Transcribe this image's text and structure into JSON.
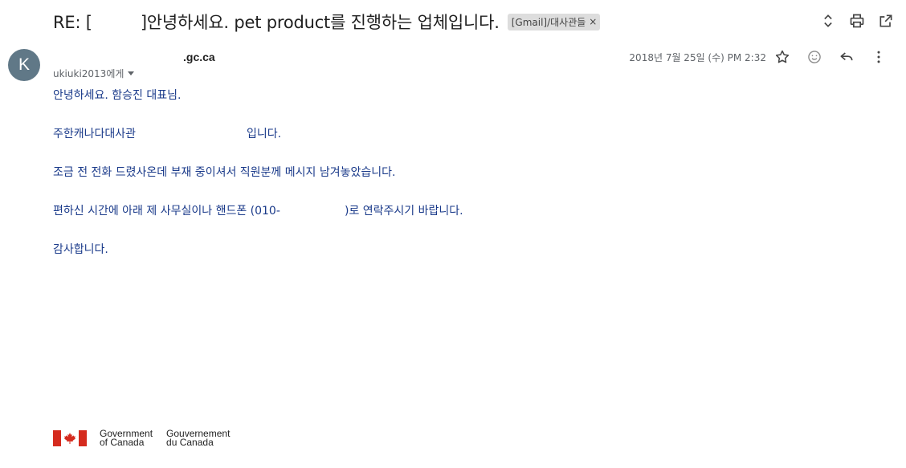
{
  "subject": {
    "prefix": "RE: [",
    "rest": "]안녕하세요. pet product를 진행하는 업체입니다.",
    "label": "[Gmail]/대사관들",
    "label_remove": "×"
  },
  "top_actions": {
    "icons": [
      "expand-collapse-icon",
      "print-icon",
      "open-in-new-window-icon"
    ]
  },
  "message": {
    "avatar_letter": "K",
    "sender": ".gc.ca",
    "recipient": "ukiuki2013에게",
    "date": "2018년 7월 25일 (수) PM 2:32",
    "icons": [
      "star-icon",
      "emoji-icon",
      "reply-icon",
      "more-vert-icon"
    ]
  },
  "body": {
    "lines": [
      "안녕하세요. 함승진 대표님.",
      "주한캐나다대사관                               입니다.",
      "조금 전 전화 드렸사온데 부재 중이셔서 직원분께 메시지 남겨놓았습니다.",
      "편하신 시간에 아래 제 사무실이나 핸드폰 (010-                  )로 연락주시기 바랍니다.",
      "감사합니다."
    ]
  },
  "signature": {
    "logo_en_1": "Government",
    "logo_en_2": "of Canada",
    "logo_fr_1": "Gouvernement",
    "logo_fr_2": "du Canada",
    "flag_color": "#d52b1e"
  }
}
